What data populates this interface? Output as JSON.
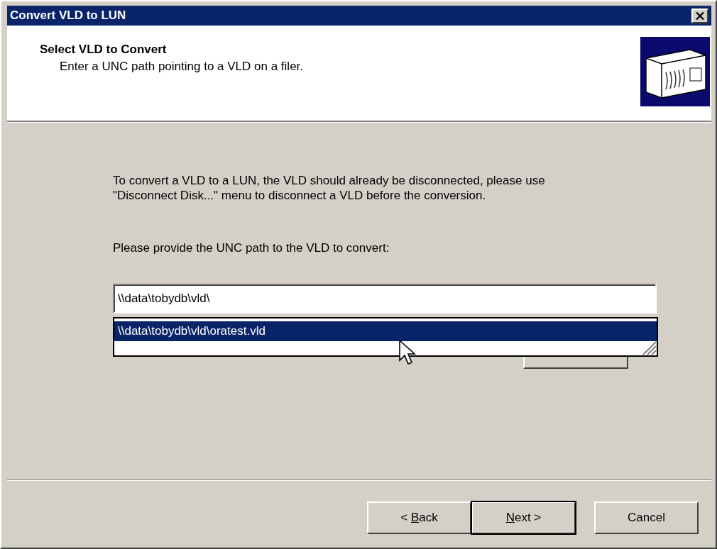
{
  "window": {
    "title": "Convert VLD to LUN"
  },
  "header": {
    "title": "Select VLD to Convert",
    "subtitle": "Enter a UNC path pointing to a VLD on a filer."
  },
  "intro": "To convert a VLD to a LUN, the VLD should already be disconnected, please use \"Disconnect Disk...\" menu to disconnect a VLD before the conversion.",
  "path_label": "Please provide the UNC path to the VLD to convert:",
  "path_field": {
    "value": "\\\\data\\tobydb\\vld\\"
  },
  "suggestions": [
    {
      "text": "\\\\data\\tobydb\\vld\\oratest.vld",
      "selected": true
    }
  ],
  "buttons": [
    {
      "before": "< ",
      "key": "B",
      "after": "ack",
      "default": false
    },
    {
      "key": "N",
      "after": "ext >",
      "default": true
    },
    {
      "before": "Cancel",
      "default": false
    }
  ]
}
